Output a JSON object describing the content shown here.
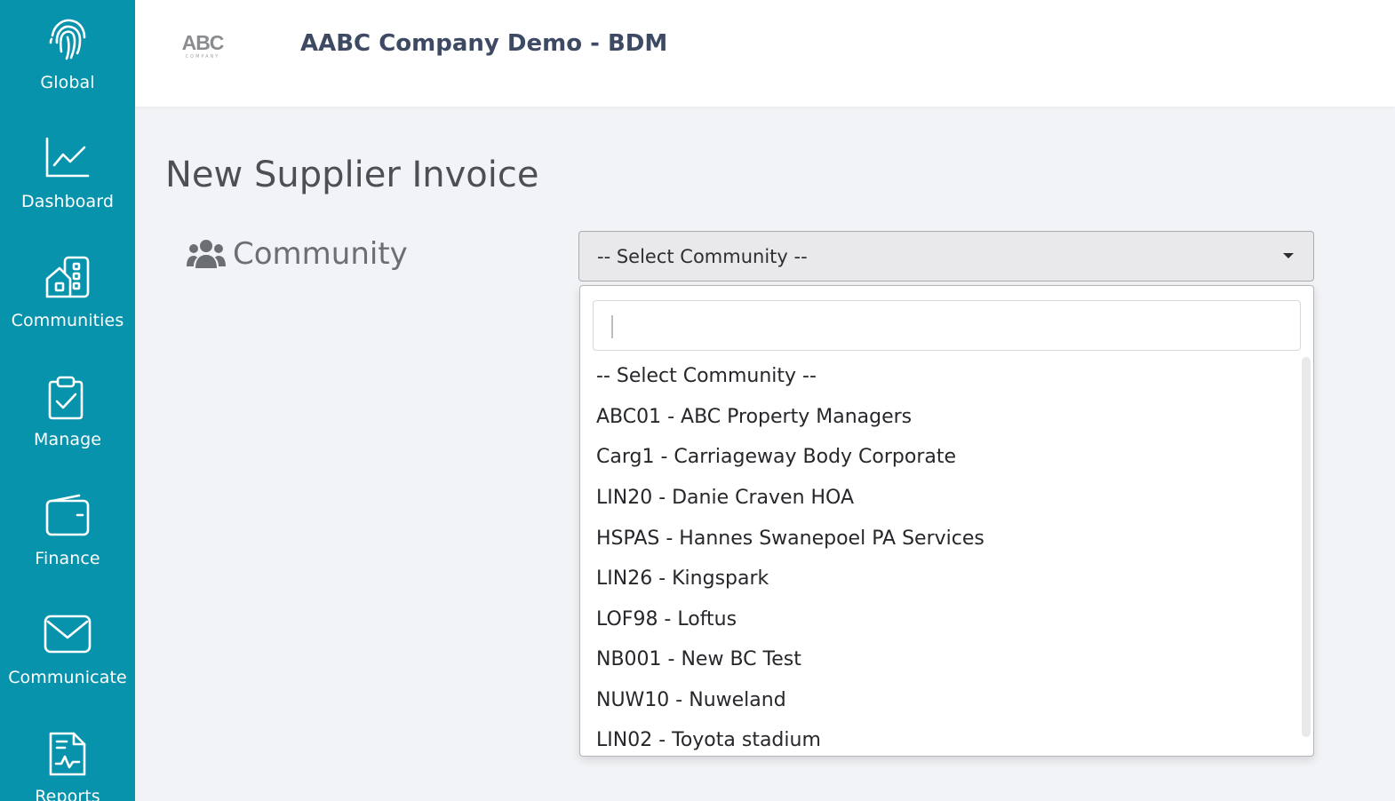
{
  "sidebar": {
    "items": [
      {
        "label": "Global",
        "icon": "fingerprint-icon"
      },
      {
        "label": "Dashboard",
        "icon": "chart-line-icon"
      },
      {
        "label": "Communities",
        "icon": "buildings-icon"
      },
      {
        "label": "Manage",
        "icon": "clipboard-check-icon"
      },
      {
        "label": "Finance",
        "icon": "wallet-icon"
      },
      {
        "label": "Communicate",
        "icon": "envelope-icon"
      },
      {
        "label": "Reports",
        "icon": "report-icon"
      }
    ],
    "background": "#0893ad"
  },
  "header": {
    "logo_text": "ABC",
    "logo_subtext": "COMPANY",
    "company_title": "AABC Company Demo - BDM"
  },
  "main": {
    "page_title": "New Supplier Invoice",
    "community_label": "Community",
    "community_icon": "users-icon",
    "select": {
      "selected": "-- Select Community --",
      "search_value": "",
      "options": [
        "-- Select Community --",
        "ABC01 - ABC Property Managers",
        "Carg1 - Carriageway Body Corporate",
        "LIN20 - Danie Craven HOA",
        "HSPAS - Hannes Swanepoel PA Services",
        "LIN26 - Kingspark",
        "LOF98 - Loftus",
        "NB001 - New BC Test",
        "NUW10 - Nuweland",
        "LIN02 - Toyota stadium"
      ]
    }
  }
}
